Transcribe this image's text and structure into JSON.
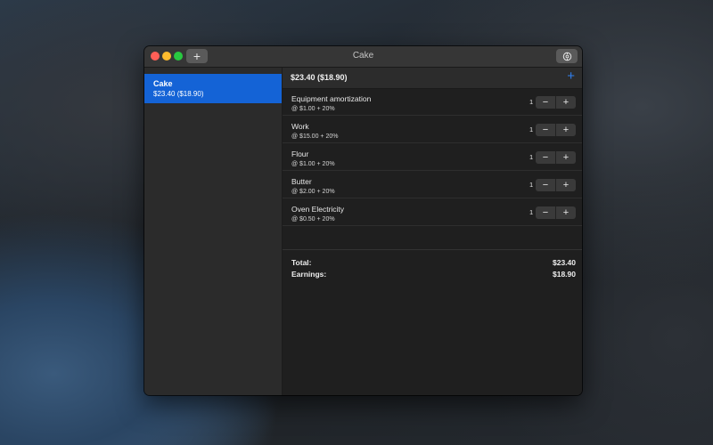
{
  "window": {
    "title": "Cake"
  },
  "toolbar": {
    "add_label": "+"
  },
  "sidebar": {
    "items": [
      {
        "name": "Cake",
        "subtitle": "$23.40 ($18.90)"
      }
    ]
  },
  "main": {
    "header_title": "$23.40 ($18.90)",
    "add_label": "+",
    "rows": [
      {
        "name": "Equipment amortization",
        "price": "@ $1.00 + 20%",
        "qty": "1"
      },
      {
        "name": "Work",
        "price": "@ $15.00 + 20%",
        "qty": "1"
      },
      {
        "name": "Flour",
        "price": "@ $1.00 + 20%",
        "qty": "1"
      },
      {
        "name": "Butter",
        "price": "@ $2.00 + 20%",
        "qty": "1"
      },
      {
        "name": "Oven Electricity",
        "price": "@ $0.50 + 20%",
        "qty": "1"
      }
    ],
    "stepper": {
      "minus": "−",
      "plus": "+"
    },
    "totals": {
      "total_label": "Total:",
      "total_value": "$23.40",
      "earnings_label": "Earnings:",
      "earnings_value": "$18.90"
    }
  },
  "colors": {
    "accent": "#1463d6",
    "add_blue": "#2f7ff0"
  }
}
